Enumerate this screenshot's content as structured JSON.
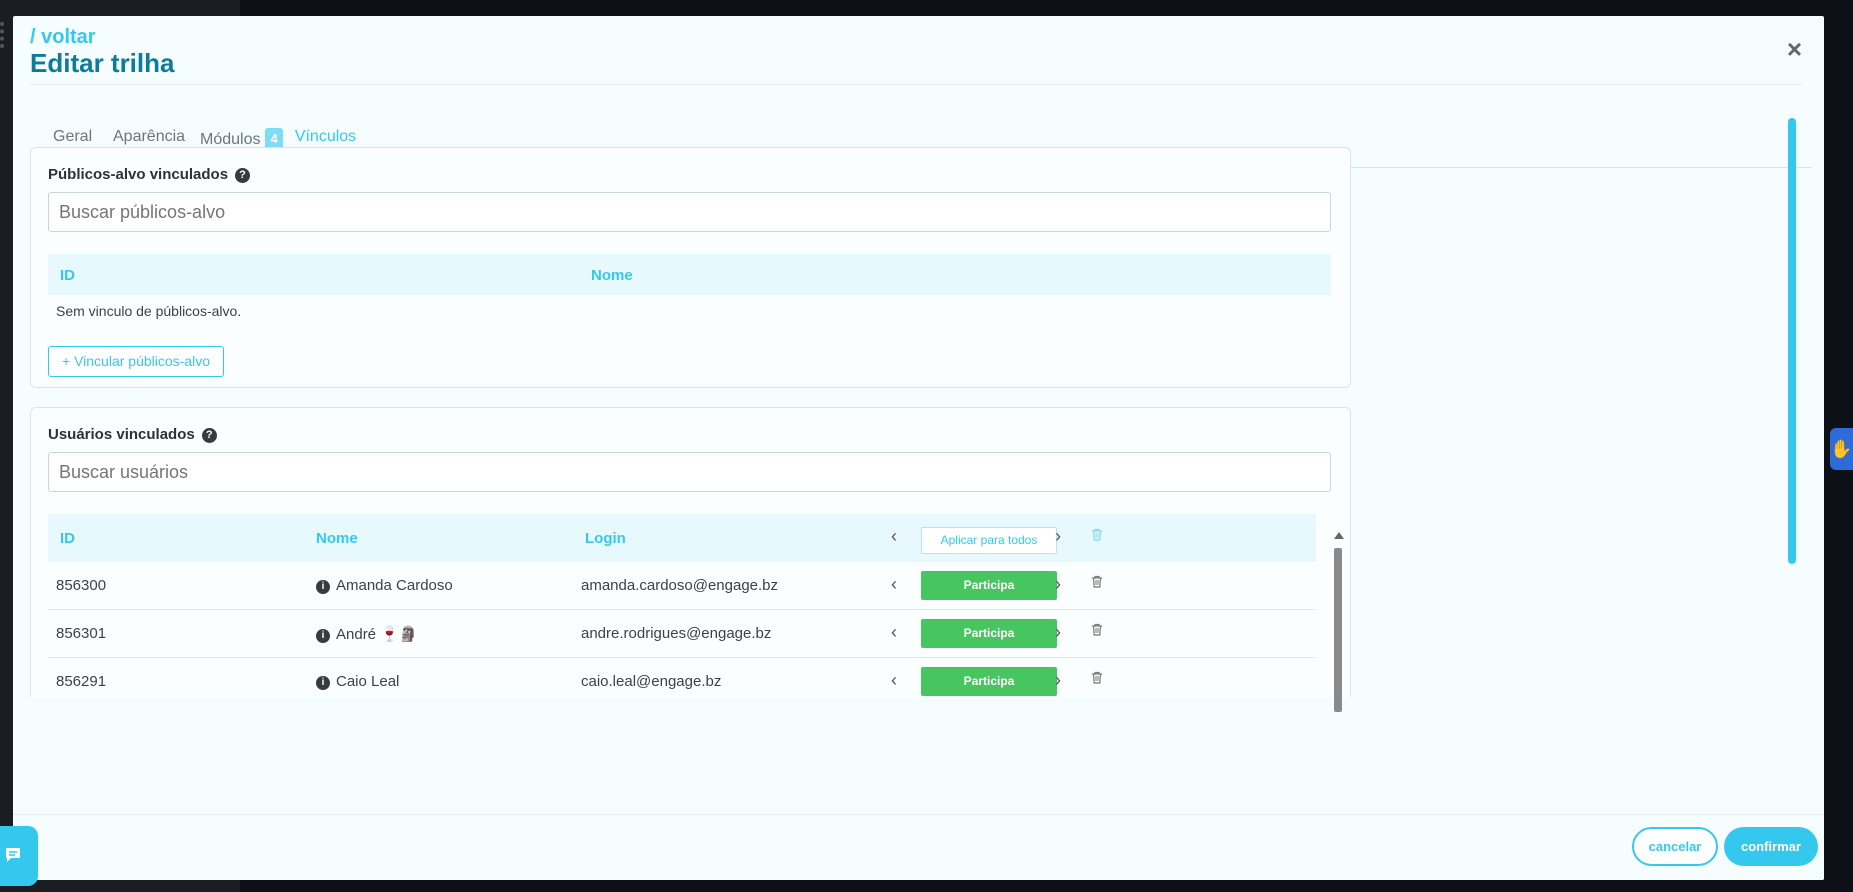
{
  "header": {
    "back_link": "/ voltar",
    "title": "Editar trilha",
    "close_glyph": "×"
  },
  "tabs": [
    {
      "label": "Geral",
      "active": false
    },
    {
      "label": "Aparência",
      "active": false
    },
    {
      "label": "Módulos",
      "badge": "4",
      "active": false
    },
    {
      "label": "Vínculos",
      "active": true
    }
  ],
  "audiences": {
    "title": "Públicos-alvo vinculados",
    "help_glyph": "?",
    "search_placeholder": "Buscar públicos-alvo",
    "columns": {
      "id": "ID",
      "name": "Nome"
    },
    "empty_message": "Sem vinculo de públicos-alvo.",
    "link_button": "+ Vincular públicos-alvo"
  },
  "users": {
    "title": "Usuários vinculados",
    "help_glyph": "?",
    "search_placeholder": "Buscar usuários",
    "columns": {
      "id": "ID",
      "name": "Nome",
      "login": "Login"
    },
    "apply_all_label": "Aplicar para todos",
    "rows": [
      {
        "id": "856300",
        "name": "Amanda Cardoso",
        "login": "amanda.cardoso@engage.bz",
        "status": "Participa"
      },
      {
        "id": "856301",
        "name": "André 🍷🗿",
        "login": "andre.rodrigues@engage.bz",
        "status": "Participa"
      },
      {
        "id": "856291",
        "name": "Caio Leal",
        "login": "caio.leal@engage.bz",
        "status": "Participa"
      }
    ]
  },
  "footer": {
    "cancel_label": "cancelar",
    "confirm_label": "confirmar"
  },
  "icons": {
    "chevron_left": "‹",
    "chevron_right": "›",
    "info": "i",
    "accessibility": "✋"
  },
  "colors": {
    "accent": "#35c8ef",
    "title": "#0d7c9c",
    "participa_green": "#47c561",
    "sign_language_widget": "#2c6bd8"
  }
}
